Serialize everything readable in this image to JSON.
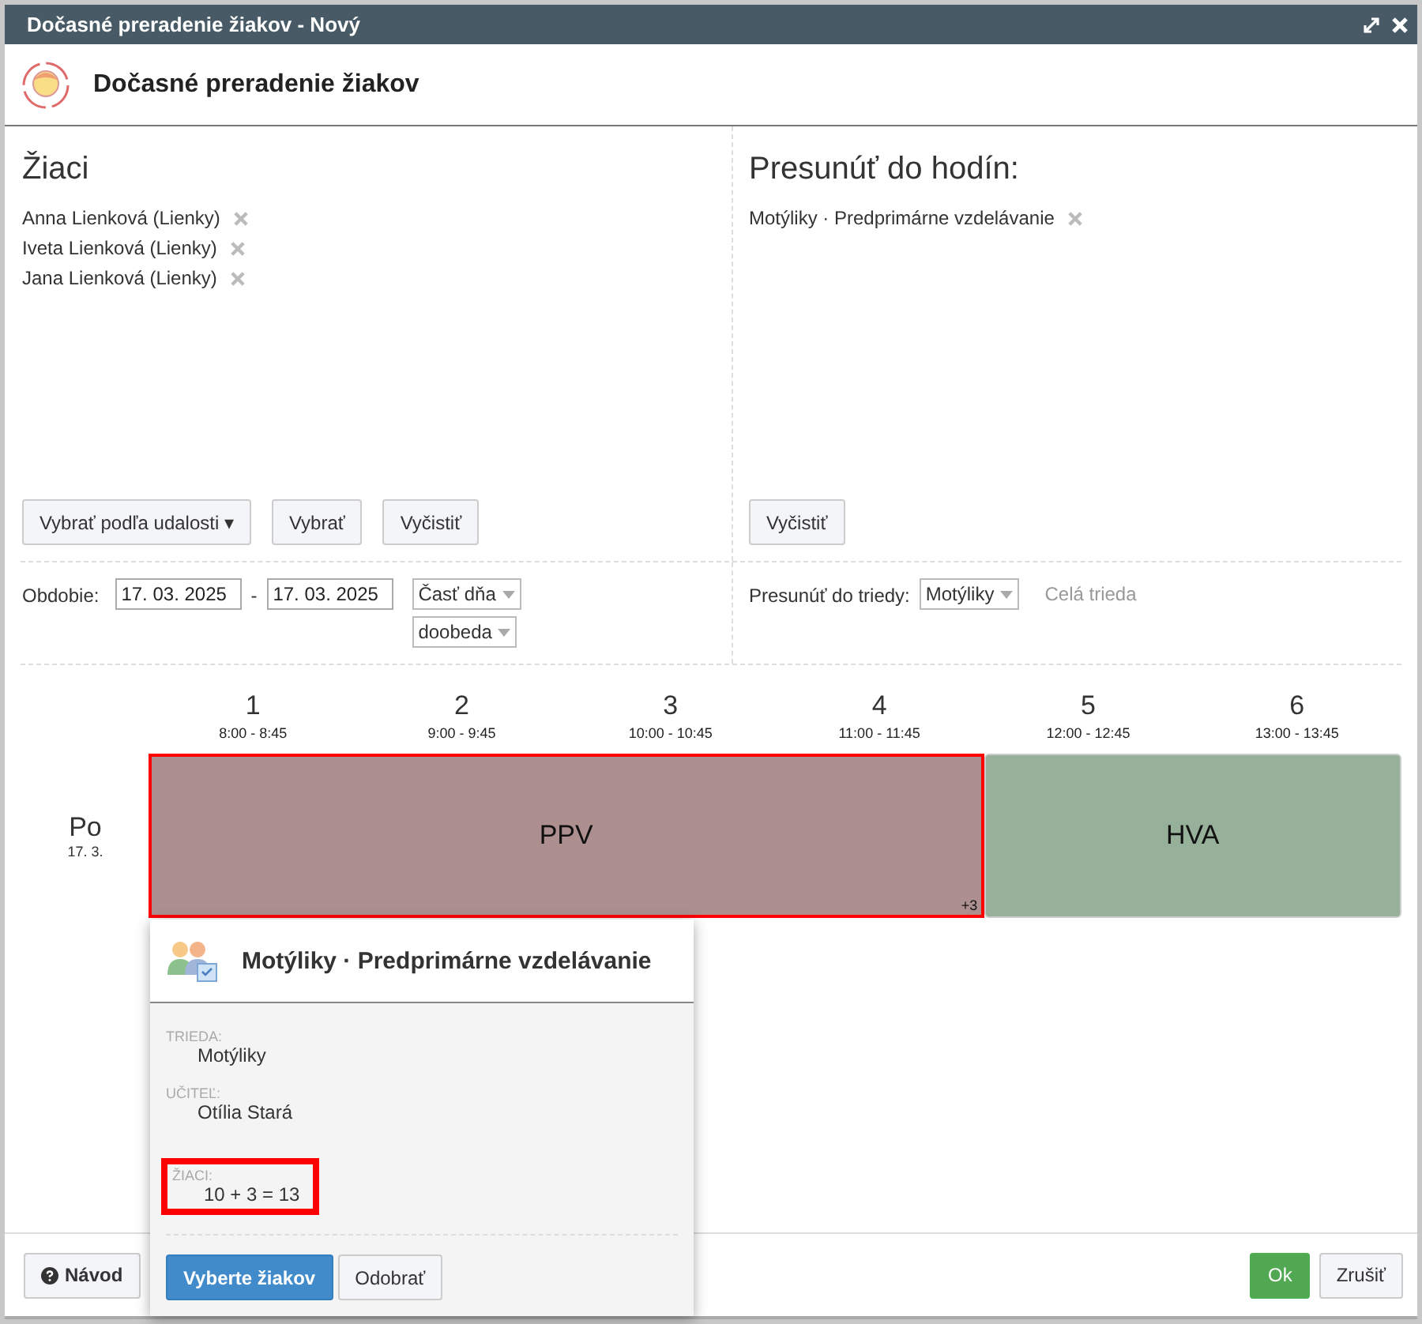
{
  "window": {
    "title": "Dočasné preradenie žiakov - Nový"
  },
  "header": {
    "title": "Dočasné preradenie žiakov"
  },
  "students": {
    "heading": "Žiaci",
    "items": [
      {
        "name": "Anna Lienková (Lienky)"
      },
      {
        "name": "Iveta Lienková (Lienky)"
      },
      {
        "name": "Jana Lienková (Lienky)"
      }
    ],
    "buttons": [
      {
        "label": "Vybrať podľa udalosti ▾"
      },
      {
        "label": "Vybrať"
      },
      {
        "label": "Vyčistiť"
      }
    ]
  },
  "target": {
    "heading": "Presunúť do hodín:",
    "items": [
      {
        "name": "Motýliky · Predprimárne vzdelávanie"
      }
    ],
    "buttons": [
      {
        "label": "Vyčistiť"
      }
    ]
  },
  "period": {
    "label": "Obdobie:",
    "from": "17. 03. 2025",
    "separator": "-",
    "to": "17. 03. 2025",
    "selects": [
      {
        "value": "Časť dňa"
      },
      {
        "value": "doobeda"
      }
    ]
  },
  "move_to_class": {
    "label": "Presunúť do triedy:",
    "value": "Motýliky",
    "link": "Celá trieda"
  },
  "timetable": {
    "lessons": [
      {
        "number": "1",
        "time": "8:00 - 8:45"
      },
      {
        "number": "2",
        "time": "9:00 - 9:45"
      },
      {
        "number": "3",
        "time": "10:00 - 10:45"
      },
      {
        "number": "4",
        "time": "11:00 - 11:45"
      },
      {
        "number": "5",
        "time": "12:00 - 12:45"
      },
      {
        "number": "6",
        "time": "13:00 - 13:45"
      }
    ],
    "day": {
      "name": "Po",
      "date": "17. 3."
    },
    "events": [
      {
        "label": "PPV",
        "color": "#ad8f8f",
        "selected": true,
        "badge": "+3"
      },
      {
        "label": "HVA",
        "color": "#96b09a",
        "selected": false
      }
    ]
  },
  "popup": {
    "title": "Motýliky · Predprimárne vzdelávanie",
    "fields": [
      {
        "label": "TRIEDA:",
        "value": "Motýliky",
        "highlighted": false
      },
      {
        "label": "UČITEĽ:",
        "value": "Otília Stará",
        "highlighted": false
      },
      {
        "label": "ŽIACI:",
        "value": "10 + 3 = 13",
        "highlighted": true
      }
    ],
    "buttons": [
      {
        "label": "Vyberte žiakov",
        "kind": "primary"
      },
      {
        "label": "Odobrať",
        "kind": "default"
      }
    ]
  },
  "footer": {
    "help": "Návod",
    "buttons": [
      {
        "label": "Ok",
        "kind": "success"
      },
      {
        "label": "Zrušiť",
        "kind": "default"
      }
    ]
  }
}
